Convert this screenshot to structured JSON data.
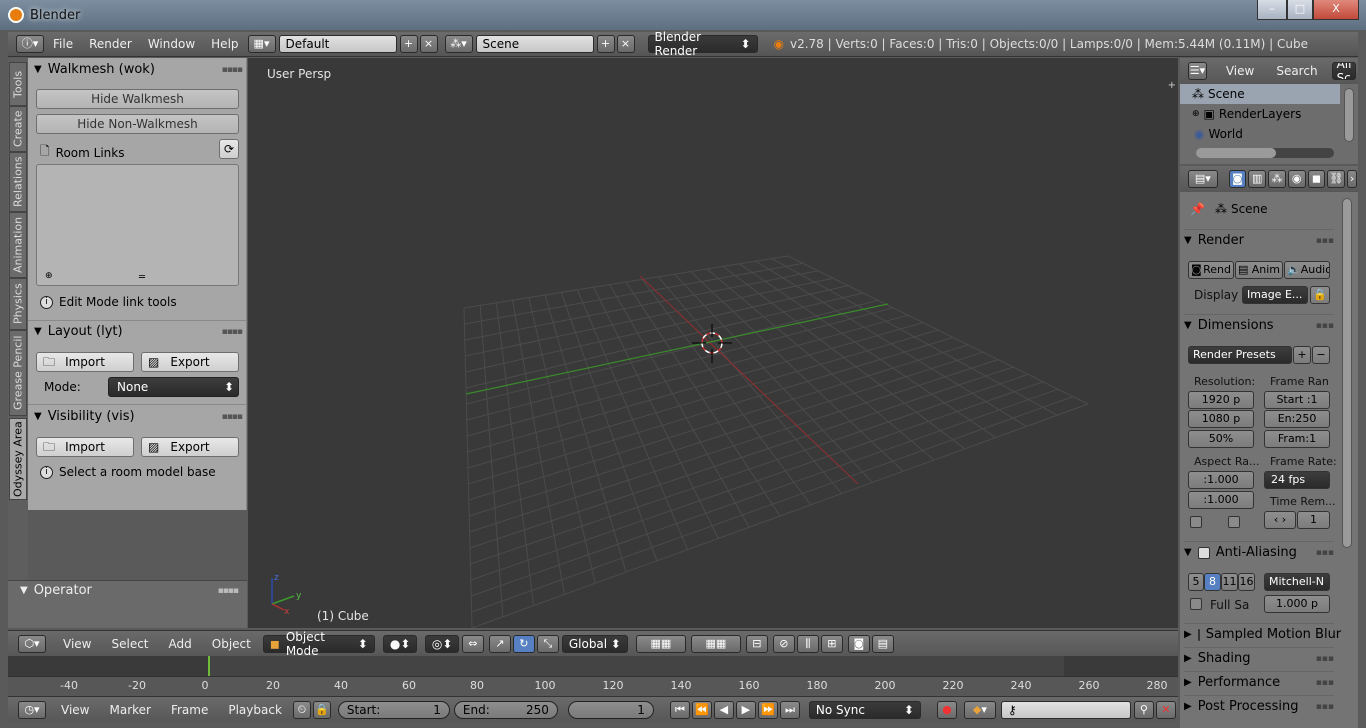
{
  "window": {
    "title": "Blender",
    "min": "–",
    "max": "□",
    "close": "X"
  },
  "topbar": {
    "menus": [
      "File",
      "Render",
      "Window",
      "Help"
    ],
    "screen_layout": "Default",
    "scene": "Scene",
    "engine": "Blender Render",
    "stats": "v2.78 | Verts:0 | Faces:0 | Tris:0 | Objects:0/0 | Lamps:0/0 | Mem:5.44M (0.11M) | Cube"
  },
  "tool_tabs": [
    "Tools",
    "Create",
    "Relations",
    "Animation",
    "Physics",
    "Grease Pencil",
    "Odyssey Area"
  ],
  "tool_panel": {
    "walkmesh": {
      "title": "Walkmesh (wok)",
      "hide_walkmesh": "Hide Walkmesh",
      "hide_non_walkmesh": "Hide Non-Walkmesh",
      "room_links": "Room Links",
      "edit_mode_hint": "Edit Mode link tools"
    },
    "layout": {
      "title": "Layout (lyt)",
      "import": "Import",
      "export": "Export",
      "mode_label": "Mode:",
      "mode_value": "None"
    },
    "visibility": {
      "title": "Visibility (vis)",
      "import": "Import",
      "export": "Export",
      "hint": "Select a room model base"
    }
  },
  "operator": {
    "title": "Operator"
  },
  "viewport": {
    "label": "User Persp",
    "object": "(1) Cube"
  },
  "view_header": {
    "menus": [
      "View",
      "Select",
      "Add",
      "Object"
    ],
    "mode": "Object Mode",
    "orientation": "Global"
  },
  "timeline_ruler": [
    "-40",
    "-20",
    "0",
    "20",
    "40",
    "60",
    "80",
    "100",
    "120",
    "140",
    "160",
    "180",
    "200",
    "220",
    "240",
    "260",
    "280"
  ],
  "timeline_header": {
    "menus": [
      "View",
      "Marker",
      "Frame",
      "Playback"
    ],
    "start_label": "Start:",
    "start_value": "1",
    "end_label": "End:",
    "end_value": "250",
    "current": "1",
    "sync": "No Sync"
  },
  "outliner": {
    "menus": [
      "View",
      "Search"
    ],
    "filter": "All Sc",
    "items": [
      "Scene",
      "RenderLayers",
      "World"
    ]
  },
  "properties": {
    "context": "Scene",
    "render": {
      "title": "Render",
      "rend": "Rend",
      "anim": "Anim",
      "audio": "Audio",
      "display_label": "Display",
      "display_value": "Image E..."
    },
    "dimensions": {
      "title": "Dimensions",
      "presets": "Render Presets",
      "resolution_label": "Resolution:",
      "res_x": "1920 p",
      "res_y": "1080 p",
      "res_pct": "50%",
      "frame_range_label": "Frame Ran",
      "start": "Start :1",
      "end": "En:250",
      "frame": "Fram:1",
      "aspect_label": "Aspect Ra...",
      "aspect_x": ":1.000",
      "aspect_y": ":1.000",
      "frame_rate_label": "Frame Rate:",
      "fps": "24 fps",
      "time_remap_label": "Time Rem...",
      "time_remap_value": "1"
    },
    "anti_aliasing": {
      "title": "Anti-Aliasing",
      "samples": [
        "5",
        "8",
        "11",
        "16"
      ],
      "filter": "Mitchell-N",
      "full_sample": "Full Sa",
      "size": "1.000 p"
    },
    "collapsed": [
      "Sampled Motion Blur",
      "Shading",
      "Performance",
      "Post Processing"
    ]
  },
  "colors": {
    "x_axis": "#b03030",
    "y_axis": "#3a9a2a",
    "grid": "#4a4a4a",
    "accent": "#5680c2"
  }
}
